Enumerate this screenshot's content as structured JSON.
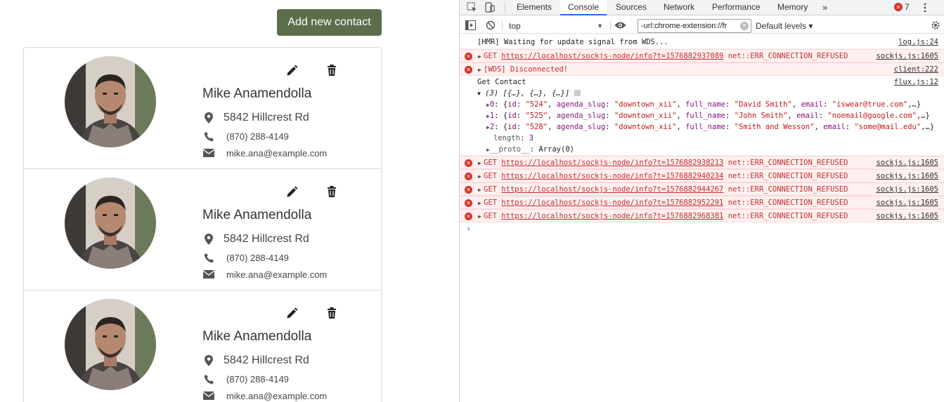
{
  "app": {
    "add_button_label": "Add new contact",
    "contacts": [
      {
        "name": "Mike Anamendolla",
        "address": "5842 Hillcrest Rd",
        "phone": "(870) 288-4149",
        "email": "mike.ana@example.com"
      },
      {
        "name": "Mike Anamendolla",
        "address": "5842 Hillcrest Rd",
        "phone": "(870) 288-4149",
        "email": "mike.ana@example.com"
      },
      {
        "name": "Mike Anamendolla",
        "address": "5842 Hillcrest Rd",
        "phone": "(870) 288-4149",
        "email": "mike.ana@example.com"
      }
    ]
  },
  "devtools": {
    "tabs": [
      "Elements",
      "Console",
      "Sources",
      "Network",
      "Performance",
      "Memory"
    ],
    "active_tab": "Console",
    "more_tabs": "»",
    "error_count": "7",
    "context": "top",
    "filter_value": "-url:chrome-extension://fr",
    "levels_label": "Default levels ▾",
    "colors": {
      "error_bg": "#fff0f0",
      "error_text": "#c42e2e",
      "accent": "#1a73e8",
      "button": "#5c6e4c"
    },
    "console": {
      "hmr": {
        "text": "[HMR] Waiting for update signal from WDS...",
        "src": "log.js:24"
      },
      "err1": {
        "method": "GET",
        "url": "https://localhost/sockjs-node/info?t=1576882937089",
        "status": "net::ERR_CONNECTION_REFUSED",
        "src": "sockjs.js:1605"
      },
      "err2": {
        "text": "[WDS] Disconnected!",
        "src": "client:222"
      },
      "group": {
        "title": "Get Contact",
        "src": "flux.js:12",
        "summary": "(3) [{…}, {…}, {…}]",
        "items": [
          {
            "idx": "0",
            "id": "\"524\"",
            "slug": "\"downtown_xii\"",
            "full_name": "\"David Smith\"",
            "email": "\"iswear@true.com\""
          },
          {
            "idx": "1",
            "id": "\"525\"",
            "slug": "\"downtown_xii\"",
            "full_name": "\"John Smith\"",
            "email": "\"noemail@google.com\""
          },
          {
            "idx": "2",
            "id": "\"528\"",
            "slug": "\"downtown_xii\"",
            "full_name": "\"Smith and Wesson\"",
            "email": "\"some@mail.edu\""
          }
        ],
        "length_key": "length",
        "length_val": "3",
        "proto_key": "__proto__",
        "proto_val": "Array(0)"
      },
      "errors": [
        {
          "method": "GET",
          "url": "https://localhost/sockjs-node/info?t=1576882938213",
          "status": "net::ERR_CONNECTION_REFUSED",
          "src": "sockjs.js:1605"
        },
        {
          "method": "GET",
          "url": "https://localhost/sockjs-node/info?t=1576882940234",
          "status": "net::ERR_CONNECTION_REFUSED",
          "src": "sockjs.js:1605"
        },
        {
          "method": "GET",
          "url": "https://localhost/sockjs-node/info?t=1576882944267",
          "status": "net::ERR_CONNECTION_REFUSED",
          "src": "sockjs.js:1605"
        },
        {
          "method": "GET",
          "url": "https://localhost/sockjs-node/info?t=1576882952291",
          "status": "net::ERR_CONNECTION_REFUSED",
          "src": "sockjs.js:1605"
        },
        {
          "method": "GET",
          "url": "https://localhost/sockjs-node/info?t=1576882968381",
          "status": "net::ERR_CONNECTION_REFUSED",
          "src": "sockjs.js:1605"
        }
      ],
      "prompt": "›"
    }
  }
}
